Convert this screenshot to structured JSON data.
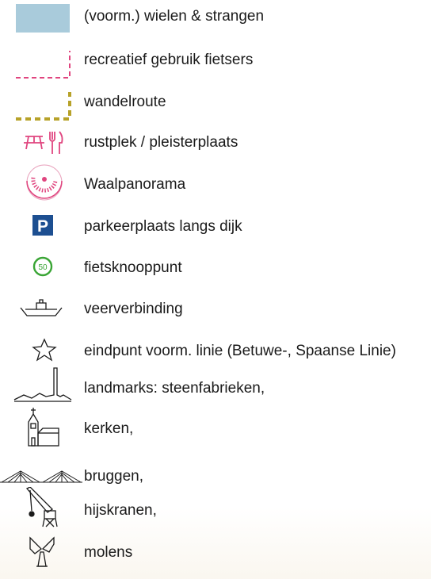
{
  "legend": {
    "items": [
      {
        "id": "wielen",
        "icon": "water-area-swatch",
        "color": "#a9cbdb",
        "label": "(voorm.) wielen & strangen"
      },
      {
        "id": "fietsers",
        "icon": "pink-dashed-line",
        "color": "#e0457f",
        "label": "recreatief gebruik fietsers"
      },
      {
        "id": "wandel",
        "icon": "olive-dashed-line",
        "color": "#b7a229",
        "label": "wandelroute"
      },
      {
        "id": "rustplek",
        "icon": "picnic-table-and-cutlery-icon",
        "color": "#e0457f",
        "label": "rustplek / pleisterplaats"
      },
      {
        "id": "panorama",
        "icon": "panorama-fan-icon",
        "color": "#e0457f",
        "label": "Waalpanorama"
      },
      {
        "id": "parkeer",
        "icon": "parking-sign-icon",
        "color": "#1d4f91",
        "symbol_text": "P",
        "label": "parkeerplaats langs dijk"
      },
      {
        "id": "knoop",
        "icon": "cycle-node-icon",
        "color": "#3aa535",
        "symbol_text": "50",
        "label": "fietsknooppunt"
      },
      {
        "id": "veer",
        "icon": "ferry-icon",
        "label": "veerverbinding"
      },
      {
        "id": "linie",
        "icon": "star-outline-icon",
        "label": "eindpunt voorm. linie (Betuwe-, Spaanse Linie)"
      },
      {
        "id": "landmark",
        "icon": "brick-factory-icon",
        "label": "landmarks: steenfabrieken,"
      },
      {
        "id": "kerk",
        "icon": "church-icon",
        "label": "kerken,"
      },
      {
        "id": "brug",
        "icon": "bridge-icon",
        "label": "bruggen,"
      },
      {
        "id": "kraan",
        "icon": "crane-icon",
        "label": "hijskranen,"
      },
      {
        "id": "molen",
        "icon": "windmill-icon",
        "label": "molens"
      }
    ]
  }
}
